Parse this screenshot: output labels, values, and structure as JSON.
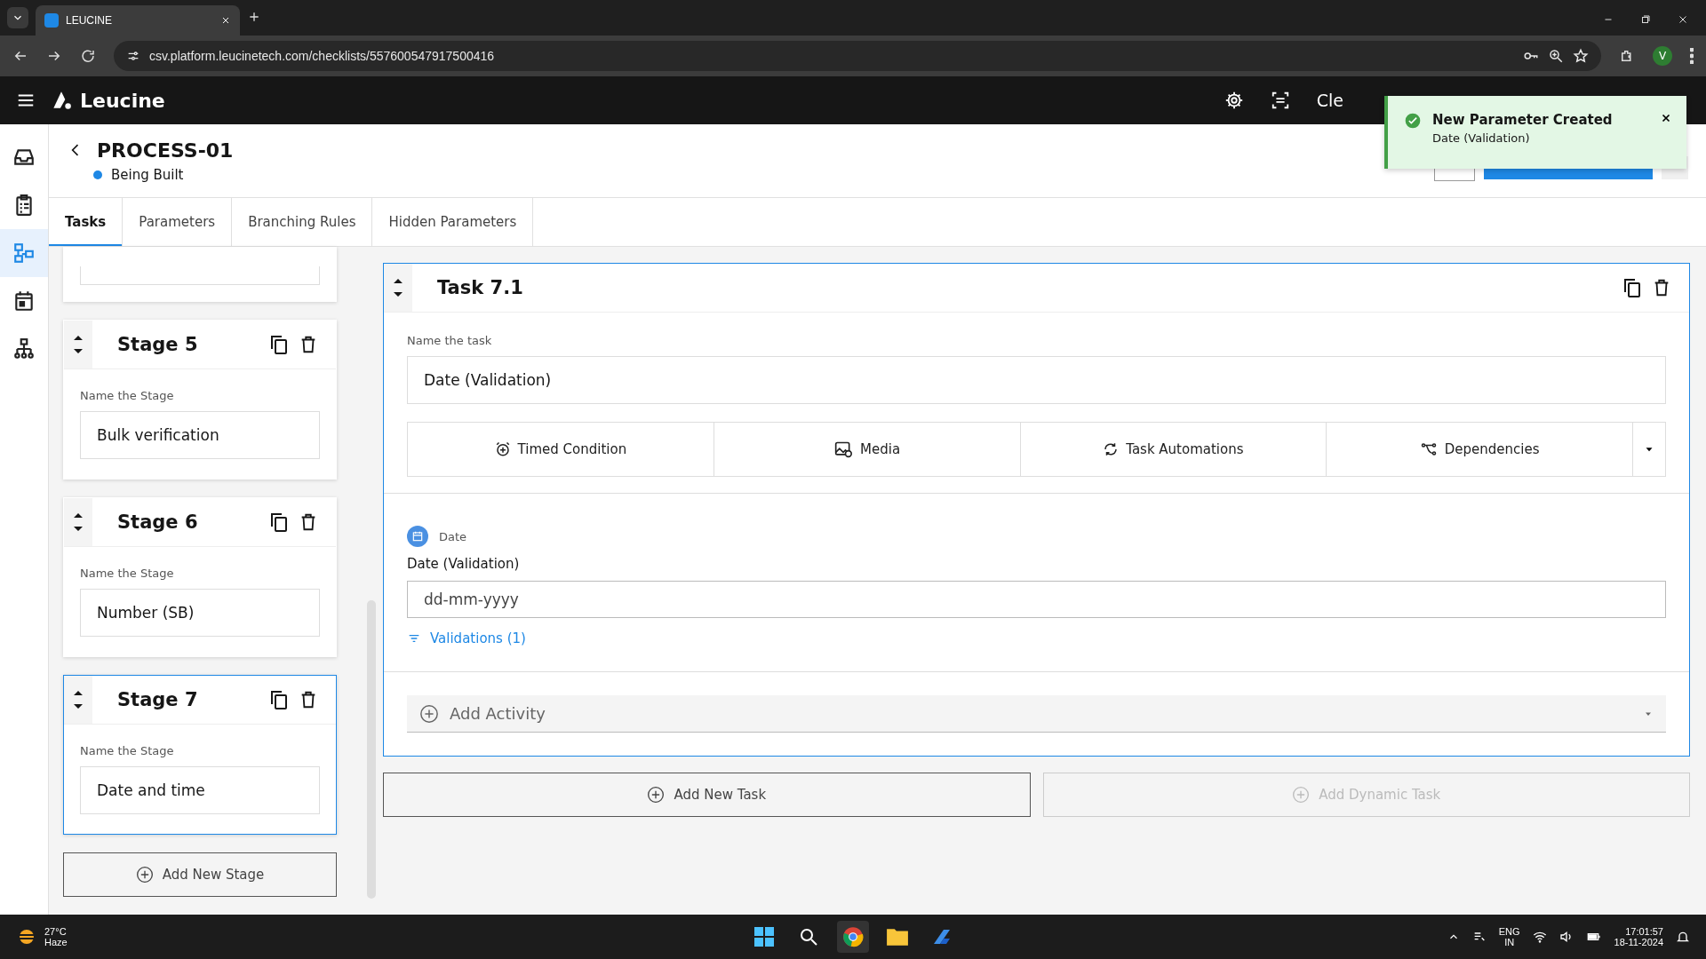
{
  "browser": {
    "tab_title": "LEUCINE",
    "url": "csv.platform.leucinetech.com/checklists/557600547917500416",
    "profile": "V"
  },
  "app": {
    "logo": "Leucine",
    "header_text": "Cle"
  },
  "toast": {
    "title": "New Parameter Created",
    "message": "Date (Validation)"
  },
  "sidebar": {
    "items": [
      {
        "kind": "inbox",
        "selected": false
      },
      {
        "kind": "checklist",
        "selected": false
      },
      {
        "kind": "flow",
        "selected": true
      },
      {
        "kind": "calendar",
        "selected": false
      },
      {
        "kind": "hierarchy",
        "selected": false
      }
    ]
  },
  "process": {
    "title": "PROCESS-01",
    "status": "Being Built"
  },
  "tabs": [
    {
      "label": "Tasks",
      "selected": true
    },
    {
      "label": "Parameters",
      "selected": false
    },
    {
      "label": "Branching Rules",
      "selected": false
    },
    {
      "label": "Hidden Parameters",
      "selected": false
    }
  ],
  "stages": [
    {
      "title": "Stage 5",
      "label": "Name the Stage",
      "name": "Bulk verification",
      "selected": false
    },
    {
      "title": "Stage 6",
      "label": "Name the Stage",
      "name": "Number (SB)",
      "selected": false
    },
    {
      "title": "Stage 7",
      "label": "Name the Stage",
      "name": "Date and time",
      "selected": true
    }
  ],
  "add_stage": "Add New Stage",
  "task": {
    "title": "Task 7.1",
    "name_label": "Name the task",
    "name": "Date (Validation)",
    "actions": [
      {
        "kind": "timer",
        "label": "Timed Condition"
      },
      {
        "kind": "media",
        "label": "Media"
      },
      {
        "kind": "automation",
        "label": "Task Automations"
      },
      {
        "kind": "dependency",
        "label": "Dependencies"
      }
    ],
    "parameter": {
      "type_label": "Date",
      "label": "Date (Validation)",
      "placeholder": "dd-mm-yyyy",
      "validations": "Validations (1)"
    },
    "add_activity": "Add Activity"
  },
  "add_task": {
    "label": "Add New Task",
    "disabled": false
  },
  "add_dynamic_task": {
    "label": "Add Dynamic Task",
    "disabled": true
  },
  "taskbar": {
    "temperature": "27°C",
    "condition": "Haze",
    "language": "ENG",
    "region": "IN",
    "time": "17:01:57",
    "date": "18-11-2024"
  }
}
